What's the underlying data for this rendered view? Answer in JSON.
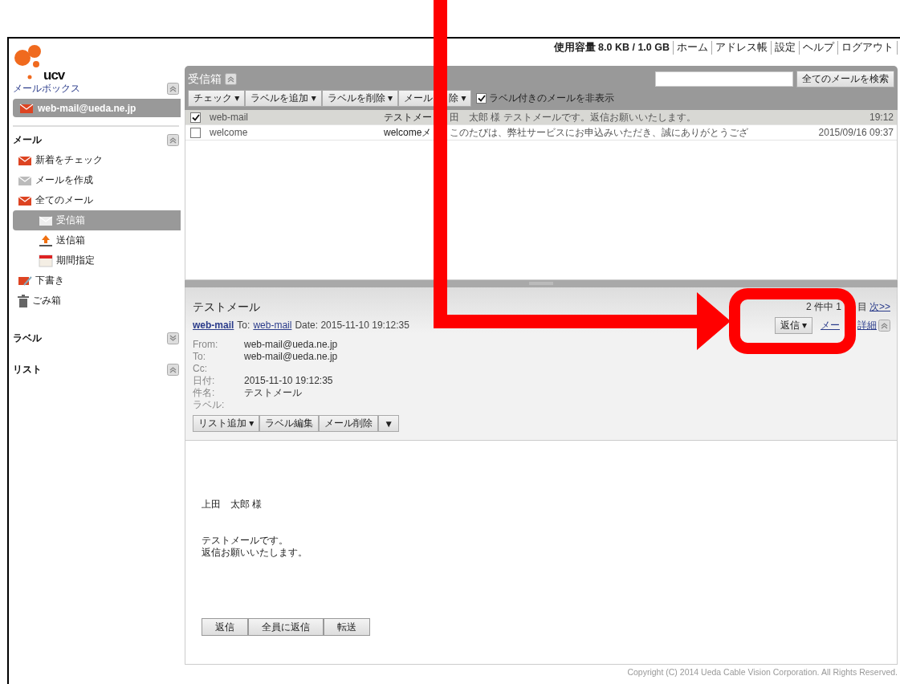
{
  "logo": {
    "text": "ucv"
  },
  "top_bar": {
    "usage": "使用容量 8.0 KB / 1.0 GB",
    "links": [
      "ホーム",
      "アドレス帳",
      "設定",
      "ヘルプ",
      "ログアウト"
    ]
  },
  "sidebar": {
    "mailbox_title": "メールボックス",
    "account": "web-mail@ueda.ne.jp",
    "sections": [
      {
        "title": "メール",
        "expanded": true,
        "items": [
          {
            "label": "新着をチェック",
            "kind": "check",
            "selected": false
          },
          {
            "label": "メールを作成",
            "kind": "compose",
            "selected": false
          },
          {
            "label": "全てのメール",
            "kind": "all",
            "selected": false,
            "children": [
              {
                "label": "受信箱",
                "kind": "inbox",
                "selected": true
              },
              {
                "label": "送信箱",
                "kind": "sent",
                "selected": false
              },
              {
                "label": "期間指定",
                "kind": "calendar",
                "selected": false
              }
            ]
          },
          {
            "label": "下書き",
            "kind": "draft",
            "selected": false
          },
          {
            "label": "ごみ箱",
            "kind": "trash",
            "selected": false
          }
        ]
      },
      {
        "title": "ラベル",
        "expanded": false
      },
      {
        "title": "リスト",
        "expanded": true
      }
    ]
  },
  "inbox": {
    "title": "受信箱",
    "search_button": "全てのメールを検索",
    "toolbar": [
      {
        "label": "チェック ▾"
      },
      {
        "label": "ラベルを追加 ▾"
      },
      {
        "label": "ラベルを削除 ▾"
      },
      {
        "label": "メール",
        "label_after": "除 ▾"
      }
    ],
    "hide_labeled": {
      "label": "ラベル付きのメールを非表示",
      "checked": true
    },
    "messages": [
      {
        "from": "web-mail",
        "subject": "テストメー",
        "preview": "田　太郎 様 テストメールです。返信お願いいたします。",
        "time": "19:12",
        "checked": true,
        "selected": true
      },
      {
        "from": "welcome",
        "subject": "welcomeメ",
        "preview": "このたびは、弊社サービスにお申込みいただき、誠にありがとうござ",
        "time": "2015/09/16 09:37",
        "checked": false,
        "selected": false
      }
    ]
  },
  "preview": {
    "subject": "テストメール",
    "from_link": "web-mail",
    "to_label": "To:",
    "to_link": "web-mail",
    "date": "Date: 2015-11-10 19:12:35",
    "pager": "2 件中 1",
    "pager_after": "目",
    "next": "次>>",
    "reply_button": "返信 ▾",
    "detail_link": "メー",
    "detail_link_after": "詳細",
    "headers": [
      {
        "name": "From:",
        "value": "web-mail@ueda.ne.jp"
      },
      {
        "name": "To:",
        "value": "web-mail@ueda.ne.jp"
      },
      {
        "name": "Cc:"
      },
      {
        "name": "日付:",
        "value": "2015-11-10 19:12:35"
      },
      {
        "name": "件名:",
        "value": "テストメール"
      },
      {
        "name": "ラベル:"
      }
    ],
    "actions": [
      "リスト追加 ▾",
      "ラベル編集",
      "メール削除",
      "▼"
    ],
    "body": [
      [
        "上田　太郎 様"
      ],
      [
        "テストメールです。",
        "返信お願いいたします。"
      ]
    ],
    "bottom_buttons": [
      "返信",
      "全員に返信",
      "転送"
    ]
  },
  "copyright": "Copyright (C) 2014 Ueda Cable Vision Corporation. All Rights Reserved."
}
